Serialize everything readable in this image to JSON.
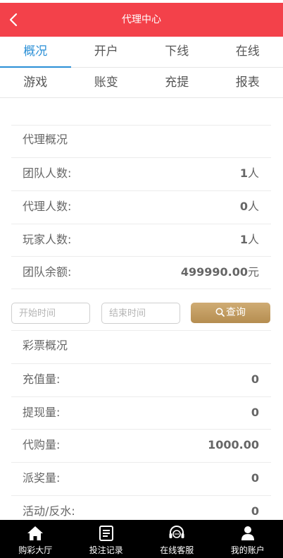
{
  "header": {
    "title": "代理中心"
  },
  "tabs_row1": [
    {
      "label": "概况",
      "active": true
    },
    {
      "label": "开户",
      "active": false
    },
    {
      "label": "下线",
      "active": false
    },
    {
      "label": "在线",
      "active": false
    }
  ],
  "tabs_row2": [
    {
      "label": "游戏"
    },
    {
      "label": "账变"
    },
    {
      "label": "充提"
    },
    {
      "label": "报表"
    }
  ],
  "agent_overview": {
    "heading": "代理概况",
    "team_members": {
      "label": "团队人数:",
      "value": "1",
      "unit": "人"
    },
    "agent_count": {
      "label": "代理人数:",
      "value": "0",
      "unit": "人"
    },
    "player_count": {
      "label": "玩家人数:",
      "value": "1",
      "unit": "人"
    },
    "team_balance": {
      "label": "团队余额:",
      "value": "499990.00",
      "unit": "元"
    }
  },
  "filter": {
    "start_placeholder": "开始时间",
    "end_placeholder": "结束时间",
    "query_label": "查询"
  },
  "lottery_overview": {
    "heading": "彩票概况",
    "deposit": {
      "label": "充值量:",
      "value": "0"
    },
    "withdraw": {
      "label": "提现量:",
      "value": "0"
    },
    "purchase": {
      "label": "代购量:",
      "value": "1000.00"
    },
    "payout": {
      "label": "派奖量:",
      "value": "0"
    },
    "rebate": {
      "label": "活动/反水:",
      "value": "0"
    }
  },
  "bottom_nav": [
    {
      "label": "购彩大厅",
      "icon": "home-icon"
    },
    {
      "label": "投注记录",
      "icon": "list-icon"
    },
    {
      "label": "在线客服",
      "icon": "headset-icon"
    },
    {
      "label": "我的账户",
      "icon": "user-icon"
    }
  ],
  "colors": {
    "header": "#f3414a",
    "active_tab": "#2a8fd6",
    "query_button": "#c29c60"
  }
}
